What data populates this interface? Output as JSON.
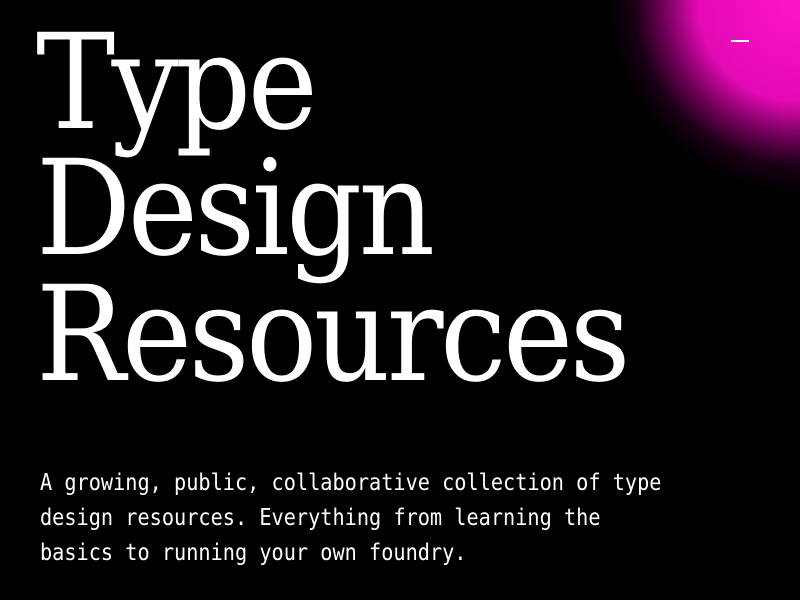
{
  "hero": {
    "title_lines": [
      "Type",
      "Design",
      "Resources"
    ],
    "description": "A growing, public, collaborative collection of type design resources. Everything from learning the basics to running your own foundry."
  },
  "menu_toggle": {
    "icon": "dash-menu-icon"
  },
  "colors": {
    "background": "#000000",
    "text": "#ffffff",
    "accent": "#ff14c8"
  }
}
